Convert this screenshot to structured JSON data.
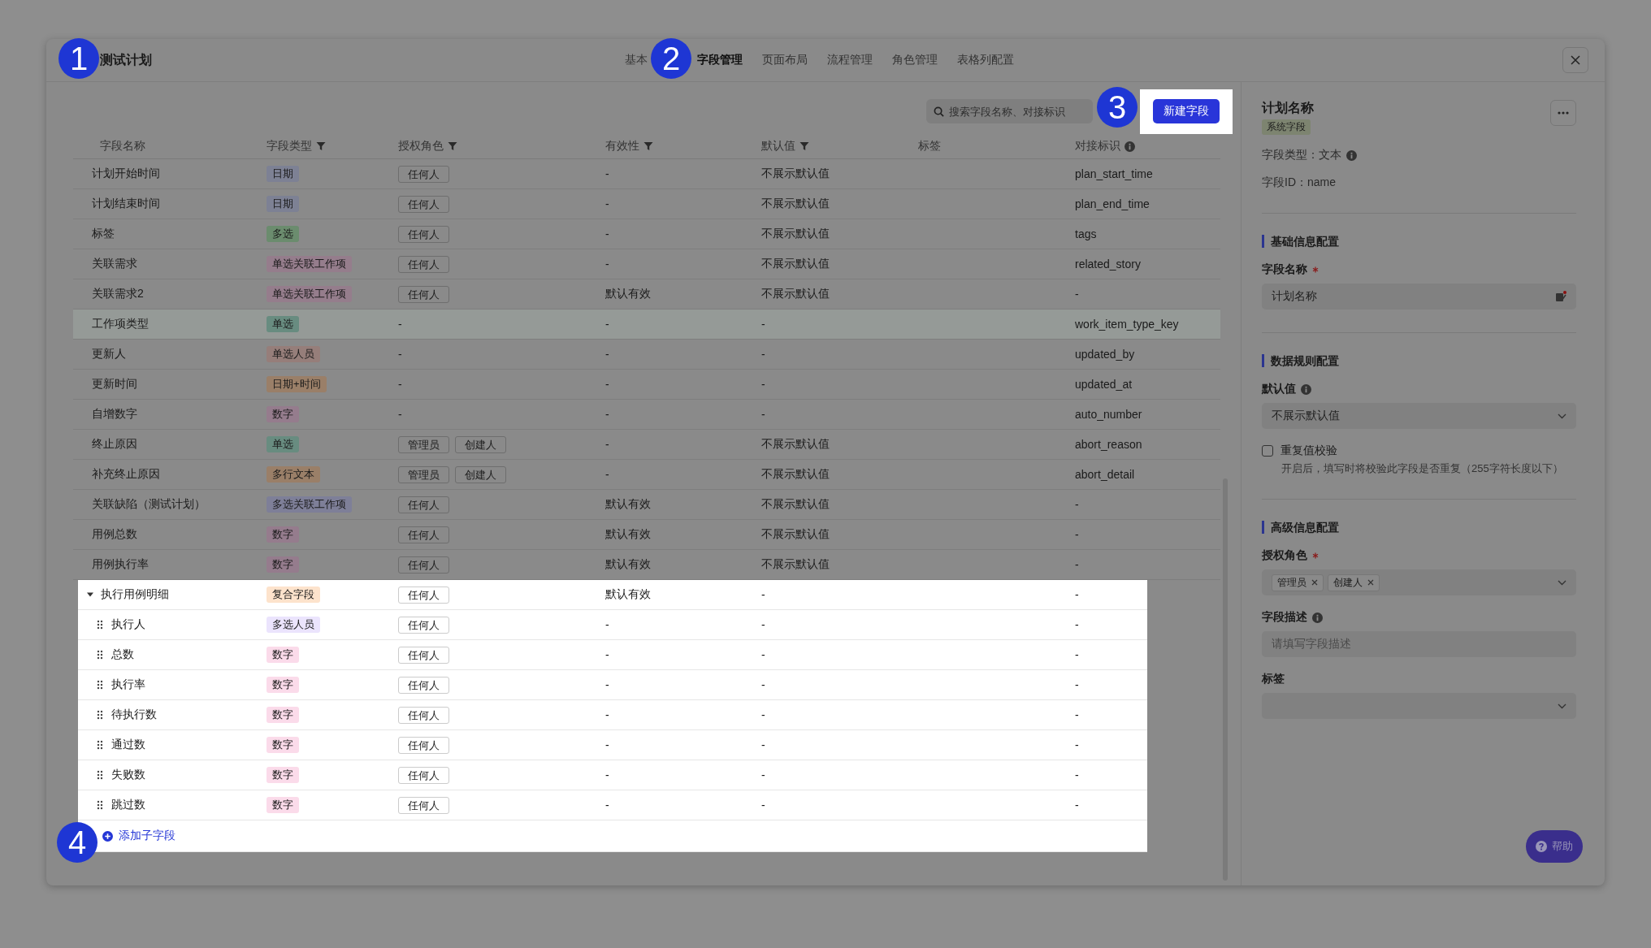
{
  "window": {
    "title": "测试计划",
    "tabs": [
      {
        "label": "基本",
        "selected": false
      },
      {
        "label": "字段管理",
        "selected": true
      },
      {
        "label": "页面布局",
        "selected": false
      },
      {
        "label": "流程管理",
        "selected": false
      },
      {
        "label": "角色管理",
        "selected": false
      },
      {
        "label": "表格列配置",
        "selected": false
      }
    ]
  },
  "callouts": [
    "1",
    "2",
    "3",
    "4"
  ],
  "toolbar": {
    "search_placeholder": "搜索字段名称、对接标识",
    "new_button": "新建字段"
  },
  "table": {
    "columns": [
      {
        "label": "字段名称"
      },
      {
        "label": "字段类型",
        "filter": true
      },
      {
        "label": "授权角色",
        "filter": true
      },
      {
        "label": "有效性",
        "filter": true
      },
      {
        "label": "默认值",
        "filter": true
      },
      {
        "label": "标签"
      },
      {
        "label": "对接标识",
        "info": true
      }
    ],
    "rows": [
      {
        "name": "计划开始时间",
        "type": {
          "label": "日期",
          "color": "#7d8194"
        },
        "roles": [
          "任何人"
        ],
        "validity": "-",
        "default": "不展示默认值",
        "key": "plan_start_time",
        "selected": false
      },
      {
        "name": "计划结束时间",
        "type": {
          "label": "日期",
          "color": "#7d8194"
        },
        "roles": [
          "任何人"
        ],
        "validity": "-",
        "default": "不展示默认值",
        "key": "plan_end_time",
        "selected": false
      },
      {
        "name": "标签",
        "type": {
          "label": "多选",
          "color": "#6b8c6e"
        },
        "roles": [
          "任何人"
        ],
        "validity": "-",
        "default": "不展示默认值",
        "key": "tags",
        "selected": false
      },
      {
        "name": "关联需求",
        "type": {
          "label": "单选关联工作项",
          "color": "#957d8c"
        },
        "roles": [
          "任何人"
        ],
        "validity": "-",
        "default": "不展示默认值",
        "key": "related_story",
        "selected": false
      },
      {
        "name": "关联需求2",
        "type": {
          "label": "单选关联工作项",
          "color": "#957d8c"
        },
        "roles": [
          "任何人"
        ],
        "validity": "默认有效",
        "default": "不展示默认值",
        "key": "-",
        "selected": false
      },
      {
        "name": "工作项类型",
        "type": {
          "label": "单选",
          "color": "#688c80"
        },
        "role": "-",
        "validity": "-",
        "default": "-",
        "key": "work_item_type_key",
        "selected": true
      },
      {
        "name": "更新人",
        "type": {
          "label": "单选人员",
          "color": "#967e7a"
        },
        "role": "-",
        "validity": "-",
        "default": "-",
        "key": "updated_by",
        "selected": false
      },
      {
        "name": "更新时间",
        "type": {
          "label": "日期+时间",
          "color": "#9a7f68"
        },
        "role": "-",
        "validity": "-",
        "default": "-",
        "key": "updated_at",
        "selected": false
      },
      {
        "name": "自增数字",
        "type": {
          "label": "数字",
          "color": "#957c8d"
        },
        "role": "-",
        "validity": "-",
        "default": "-",
        "key": "auto_number",
        "selected": false
      },
      {
        "name": "终止原因",
        "type": {
          "label": "单选",
          "color": "#688c80"
        },
        "roles": [
          "管理员",
          "创建人"
        ],
        "validity": "-",
        "default": "不展示默认值",
        "key": "abort_reason",
        "selected": false
      },
      {
        "name": "补充终止原因",
        "type": {
          "label": "多行文本",
          "color": "#9a7f68"
        },
        "roles": [
          "管理员",
          "创建人"
        ],
        "validity": "-",
        "default": "不展示默认值",
        "key": "abort_detail",
        "selected": false
      },
      {
        "name": "关联缺陷（测试计划）",
        "type": {
          "label": "多选关联工作项",
          "color": "#7e7f98"
        },
        "roles": [
          "任何人"
        ],
        "validity": "默认有效",
        "default": "不展示默认值",
        "key": "-",
        "selected": false
      },
      {
        "name": "用例总数",
        "type": {
          "label": "数字",
          "color": "#957c8d"
        },
        "roles": [
          "任何人"
        ],
        "validity": "默认有效",
        "default": "不展示默认值",
        "key": "-",
        "selected": false
      },
      {
        "name": "用例执行率",
        "type": {
          "label": "数字",
          "color": "#957c8d"
        },
        "roles": [
          "任何人"
        ],
        "validity": "默认有效",
        "default": "不展示默认值",
        "key": "-",
        "selected": false
      },
      {
        "name": "执行用例明细",
        "type": {
          "label": "复合字段",
          "color": "#fde3cc"
        },
        "roles": [
          "任何人"
        ],
        "validity": "默认有效",
        "default": "-",
        "key": "-",
        "selected": false,
        "expanded": true,
        "children": [
          {
            "name": "执行人",
            "type": {
              "label": "多选人员",
              "color": "#ebe4fd"
            },
            "roles": [
              "任何人"
            ],
            "validity": "-",
            "default": "-",
            "key": "-"
          },
          {
            "name": "总数",
            "type": {
              "label": "数字",
              "color": "#fbdbea"
            },
            "roles": [
              "任何人"
            ],
            "validity": "-",
            "default": "-",
            "key": "-"
          },
          {
            "name": "执行率",
            "type": {
              "label": "数字",
              "color": "#fbdbea"
            },
            "roles": [
              "任何人"
            ],
            "validity": "-",
            "default": "-",
            "key": "-"
          },
          {
            "name": "待执行数",
            "type": {
              "label": "数字",
              "color": "#fbdbea"
            },
            "roles": [
              "任何人"
            ],
            "validity": "-",
            "default": "-",
            "key": "-"
          },
          {
            "name": "通过数",
            "type": {
              "label": "数字",
              "color": "#fbdbea"
            },
            "roles": [
              "任何人"
            ],
            "validity": "-",
            "default": "-",
            "key": "-"
          },
          {
            "name": "失败数",
            "type": {
              "label": "数字",
              "color": "#fbdbea"
            },
            "roles": [
              "任何人"
            ],
            "validity": "-",
            "default": "-",
            "key": "-"
          },
          {
            "name": "跳过数",
            "type": {
              "label": "数字",
              "color": "#fbdbea"
            },
            "roles": [
              "任何人"
            ],
            "validity": "-",
            "default": "-",
            "key": "-"
          }
        ]
      }
    ],
    "add_subfield": "添加子字段"
  },
  "detail": {
    "title": "计划名称",
    "badge": "系统字段",
    "type_line": "字段类型：文本",
    "id_line": "字段ID：name",
    "sections": [
      {
        "heading": "基础信息配置",
        "fields": [
          {
            "kind": "input",
            "label": "字段名称",
            "required": true,
            "value": "计划名称"
          }
        ]
      },
      {
        "heading": "数据规则配置",
        "fields": [
          {
            "kind": "select",
            "label": "默认值",
            "info": true,
            "value": "不展示默认值"
          },
          {
            "kind": "checkbox",
            "label": "重复值校验",
            "checked": false,
            "hint": "开启后，填写时将校验此字段是否重复（255字符长度以下）"
          }
        ]
      },
      {
        "heading": "高级信息配置",
        "fields": [
          {
            "kind": "tags",
            "label": "授权角色",
            "required": true,
            "tags": [
              "管理员",
              "创建人"
            ]
          },
          {
            "kind": "input",
            "label": "字段描述",
            "info": true,
            "placeholder": "请填写字段描述"
          },
          {
            "kind": "select",
            "label": "标签"
          }
        ]
      }
    ]
  },
  "help_button": "帮助"
}
